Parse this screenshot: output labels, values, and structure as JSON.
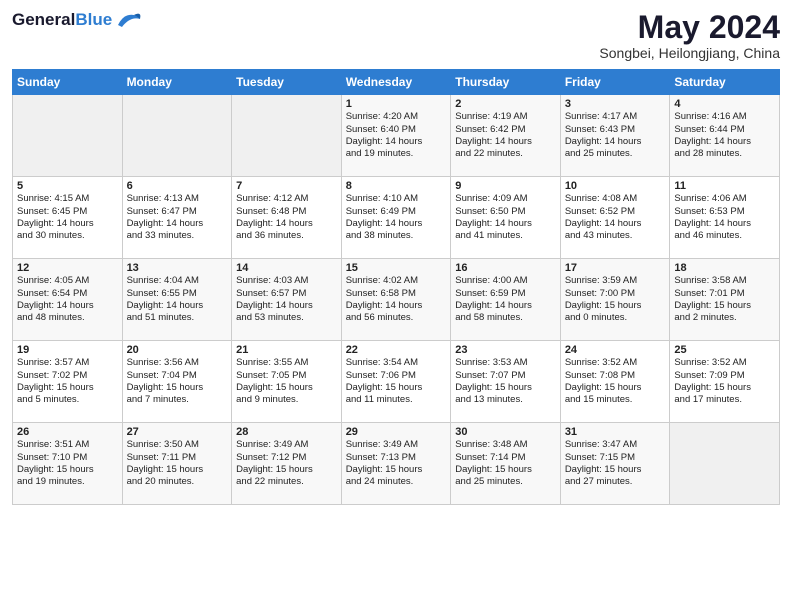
{
  "header": {
    "logo_general": "General",
    "logo_blue": "Blue",
    "month_title": "May 2024",
    "subtitle": "Songbei, Heilongjiang, China"
  },
  "days_of_week": [
    "Sunday",
    "Monday",
    "Tuesday",
    "Wednesday",
    "Thursday",
    "Friday",
    "Saturday"
  ],
  "weeks": [
    {
      "days": [
        {
          "num": "",
          "info": "",
          "empty": true
        },
        {
          "num": "",
          "info": "",
          "empty": true
        },
        {
          "num": "",
          "info": "",
          "empty": true
        },
        {
          "num": "1",
          "info": "Sunrise: 4:20 AM\nSunset: 6:40 PM\nDaylight: 14 hours\nand 19 minutes."
        },
        {
          "num": "2",
          "info": "Sunrise: 4:19 AM\nSunset: 6:42 PM\nDaylight: 14 hours\nand 22 minutes."
        },
        {
          "num": "3",
          "info": "Sunrise: 4:17 AM\nSunset: 6:43 PM\nDaylight: 14 hours\nand 25 minutes."
        },
        {
          "num": "4",
          "info": "Sunrise: 4:16 AM\nSunset: 6:44 PM\nDaylight: 14 hours\nand 28 minutes."
        }
      ]
    },
    {
      "days": [
        {
          "num": "5",
          "info": "Sunrise: 4:15 AM\nSunset: 6:45 PM\nDaylight: 14 hours\nand 30 minutes."
        },
        {
          "num": "6",
          "info": "Sunrise: 4:13 AM\nSunset: 6:47 PM\nDaylight: 14 hours\nand 33 minutes."
        },
        {
          "num": "7",
          "info": "Sunrise: 4:12 AM\nSunset: 6:48 PM\nDaylight: 14 hours\nand 36 minutes."
        },
        {
          "num": "8",
          "info": "Sunrise: 4:10 AM\nSunset: 6:49 PM\nDaylight: 14 hours\nand 38 minutes."
        },
        {
          "num": "9",
          "info": "Sunrise: 4:09 AM\nSunset: 6:50 PM\nDaylight: 14 hours\nand 41 minutes."
        },
        {
          "num": "10",
          "info": "Sunrise: 4:08 AM\nSunset: 6:52 PM\nDaylight: 14 hours\nand 43 minutes."
        },
        {
          "num": "11",
          "info": "Sunrise: 4:06 AM\nSunset: 6:53 PM\nDaylight: 14 hours\nand 46 minutes."
        }
      ]
    },
    {
      "days": [
        {
          "num": "12",
          "info": "Sunrise: 4:05 AM\nSunset: 6:54 PM\nDaylight: 14 hours\nand 48 minutes."
        },
        {
          "num": "13",
          "info": "Sunrise: 4:04 AM\nSunset: 6:55 PM\nDaylight: 14 hours\nand 51 minutes."
        },
        {
          "num": "14",
          "info": "Sunrise: 4:03 AM\nSunset: 6:57 PM\nDaylight: 14 hours\nand 53 minutes."
        },
        {
          "num": "15",
          "info": "Sunrise: 4:02 AM\nSunset: 6:58 PM\nDaylight: 14 hours\nand 56 minutes."
        },
        {
          "num": "16",
          "info": "Sunrise: 4:00 AM\nSunset: 6:59 PM\nDaylight: 14 hours\nand 58 minutes."
        },
        {
          "num": "17",
          "info": "Sunrise: 3:59 AM\nSunset: 7:00 PM\nDaylight: 15 hours\nand 0 minutes."
        },
        {
          "num": "18",
          "info": "Sunrise: 3:58 AM\nSunset: 7:01 PM\nDaylight: 15 hours\nand 2 minutes."
        }
      ]
    },
    {
      "days": [
        {
          "num": "19",
          "info": "Sunrise: 3:57 AM\nSunset: 7:02 PM\nDaylight: 15 hours\nand 5 minutes."
        },
        {
          "num": "20",
          "info": "Sunrise: 3:56 AM\nSunset: 7:04 PM\nDaylight: 15 hours\nand 7 minutes."
        },
        {
          "num": "21",
          "info": "Sunrise: 3:55 AM\nSunset: 7:05 PM\nDaylight: 15 hours\nand 9 minutes."
        },
        {
          "num": "22",
          "info": "Sunrise: 3:54 AM\nSunset: 7:06 PM\nDaylight: 15 hours\nand 11 minutes."
        },
        {
          "num": "23",
          "info": "Sunrise: 3:53 AM\nSunset: 7:07 PM\nDaylight: 15 hours\nand 13 minutes."
        },
        {
          "num": "24",
          "info": "Sunrise: 3:52 AM\nSunset: 7:08 PM\nDaylight: 15 hours\nand 15 minutes."
        },
        {
          "num": "25",
          "info": "Sunrise: 3:52 AM\nSunset: 7:09 PM\nDaylight: 15 hours\nand 17 minutes."
        }
      ]
    },
    {
      "days": [
        {
          "num": "26",
          "info": "Sunrise: 3:51 AM\nSunset: 7:10 PM\nDaylight: 15 hours\nand 19 minutes."
        },
        {
          "num": "27",
          "info": "Sunrise: 3:50 AM\nSunset: 7:11 PM\nDaylight: 15 hours\nand 20 minutes."
        },
        {
          "num": "28",
          "info": "Sunrise: 3:49 AM\nSunset: 7:12 PM\nDaylight: 15 hours\nand 22 minutes."
        },
        {
          "num": "29",
          "info": "Sunrise: 3:49 AM\nSunset: 7:13 PM\nDaylight: 15 hours\nand 24 minutes."
        },
        {
          "num": "30",
          "info": "Sunrise: 3:48 AM\nSunset: 7:14 PM\nDaylight: 15 hours\nand 25 minutes."
        },
        {
          "num": "31",
          "info": "Sunrise: 3:47 AM\nSunset: 7:15 PM\nDaylight: 15 hours\nand 27 minutes."
        },
        {
          "num": "",
          "info": "",
          "empty": true
        }
      ]
    }
  ]
}
